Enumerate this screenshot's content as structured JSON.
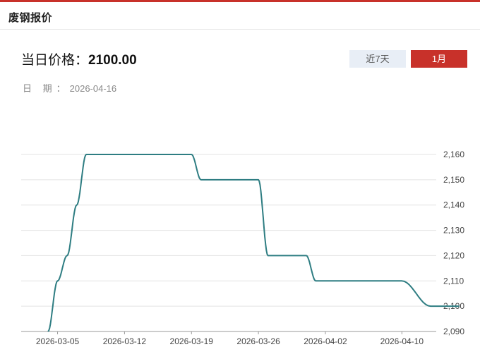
{
  "header": {
    "title": "废钢报价"
  },
  "summary": {
    "price_label": "当日价格：",
    "price_value": "2100.00",
    "date_label": "日 期：",
    "date_value": "2026-04-16"
  },
  "tabs": [
    {
      "label": "近7天",
      "active": false
    },
    {
      "label": "1月",
      "active": true
    }
  ],
  "colors": {
    "accent": "#c8312a",
    "line": "#2e7d82",
    "tab_inactive_bg": "#e8eef6"
  },
  "chart_data": {
    "type": "line",
    "title": "",
    "xlabel": "",
    "ylabel": "",
    "ylim": [
      2090,
      2160
    ],
    "y_ticks": [
      2090,
      2100,
      2110,
      2120,
      2130,
      2140,
      2150,
      2160
    ],
    "y_tick_labels": [
      "2,090",
      "2,100",
      "2,110",
      "2,120",
      "2,130",
      "2,140",
      "2,150",
      "2,160"
    ],
    "x_tick_labels": [
      "2026-03-05",
      "2026-03-12",
      "2026-03-19",
      "2026-03-26",
      "2026-04-02",
      "2026-04-10"
    ],
    "grid": true,
    "x": [
      "2026-03-04",
      "2026-03-05",
      "2026-03-06",
      "2026-03-07",
      "2026-03-08",
      "2026-03-09",
      "2026-03-10",
      "2026-03-11",
      "2026-03-12",
      "2026-03-13",
      "2026-03-16",
      "2026-03-17",
      "2026-03-18",
      "2026-03-19",
      "2026-03-20",
      "2026-03-23",
      "2026-03-24",
      "2026-03-25",
      "2026-03-26",
      "2026-03-27",
      "2026-03-30",
      "2026-03-31",
      "2026-04-01",
      "2026-04-02",
      "2026-04-03",
      "2026-04-07",
      "2026-04-08",
      "2026-04-09",
      "2026-04-10",
      "2026-04-13",
      "2026-04-14",
      "2026-04-15",
      "2026-04-16"
    ],
    "series": [
      {
        "values": [
          2090,
          2110,
          2120,
          2140,
          2160,
          2160,
          2160,
          2160,
          2160,
          2160,
          2160,
          2160,
          2160,
          2160,
          2150,
          2150,
          2150,
          2150,
          2150,
          2120,
          2120,
          2120,
          2110,
          2110,
          2110,
          2110,
          2110,
          2110,
          2110,
          2100,
          2100,
          2100,
          2100
        ]
      }
    ]
  }
}
